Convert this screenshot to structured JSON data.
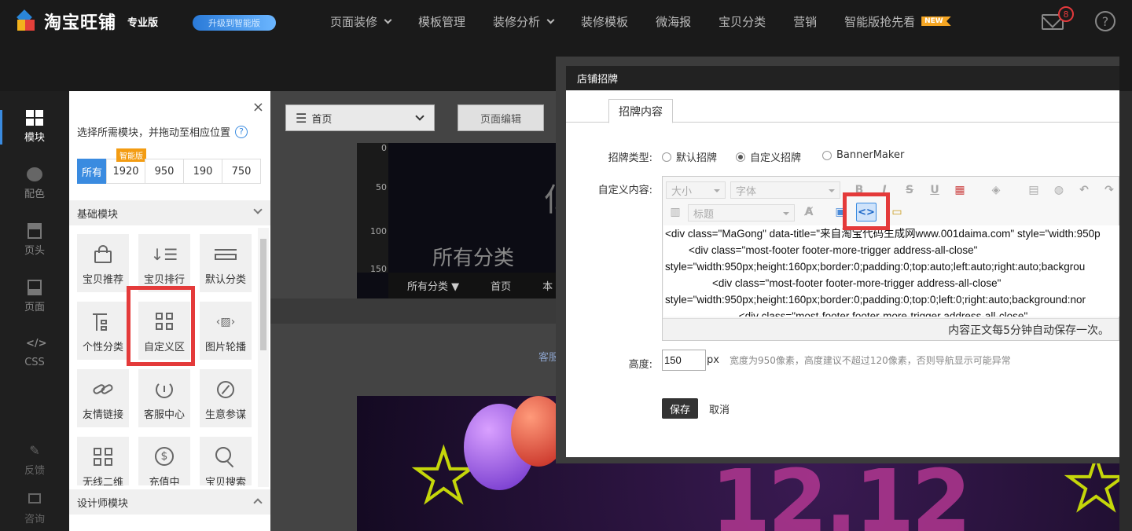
{
  "topbar": {
    "logo_text": "淘宝旺铺",
    "edition": "专业版",
    "upgrade": "升级到智能版",
    "nav": [
      {
        "label": "页面装修",
        "dropdown": true
      },
      {
        "label": "模板管理",
        "dropdown": false
      },
      {
        "label": "装修分析",
        "dropdown": true
      },
      {
        "label": "装修模板",
        "dropdown": false
      },
      {
        "label": "微海报",
        "dropdown": false
      },
      {
        "label": "宝贝分类",
        "dropdown": false
      },
      {
        "label": "营销",
        "dropdown": false
      },
      {
        "label": "智能版抢先看",
        "dropdown": false
      }
    ],
    "new_badge": "NEW",
    "mail_count": "8",
    "help": "?"
  },
  "rail": {
    "items": [
      {
        "label": "模块",
        "icon": "grid-icon"
      },
      {
        "label": "配色",
        "icon": "palette-icon"
      },
      {
        "label": "页头",
        "icon": "page-header-icon"
      },
      {
        "label": "页面",
        "icon": "page-icon"
      },
      {
        "label": "CSS",
        "icon": "code-icon"
      },
      {
        "label": "反馈",
        "icon": "edit-icon"
      },
      {
        "label": "咨询",
        "icon": "chat-icon"
      }
    ]
  },
  "panel": {
    "close": "×",
    "hint": "选择所需模块，并拖动至相应位置",
    "filters": [
      "所有",
      "1920",
      "950",
      "190",
      "750"
    ],
    "smart_badge": "智能版",
    "section_basic": "基础模块",
    "section_designer": "设计师模块",
    "modules": [
      {
        "label": "宝贝推荐",
        "icon": "bag-icon"
      },
      {
        "label": "宝贝排行",
        "icon": "ranking-icon"
      },
      {
        "label": "默认分类",
        "icon": "category-icon"
      },
      {
        "label": "个性分类",
        "icon": "tree-icon"
      },
      {
        "label": "自定义区",
        "icon": "custom-grid-icon"
      },
      {
        "label": "图片轮播",
        "icon": "carousel-icon"
      },
      {
        "label": "友情链接",
        "icon": "link-icon"
      },
      {
        "label": "客服中心",
        "icon": "service-icon"
      },
      {
        "label": "生意参谋",
        "icon": "compass-icon"
      },
      {
        "label": "无线二维",
        "icon": "qrcode-icon"
      },
      {
        "label": "充值中",
        "icon": "coin-icon"
      },
      {
        "label": "宝贝搜索",
        "icon": "search-icon"
      }
    ]
  },
  "editor": {
    "page_select": "首页",
    "page_edit": "页面编辑",
    "preview_title": "所有分类",
    "preview_big_char": "亿",
    "preview_nav": [
      "所有分类 ▼",
      "首页",
      "本"
    ],
    "ruler": [
      "0",
      "50",
      "100",
      "150"
    ],
    "kefu": "客服中",
    "banner_text": "12.12"
  },
  "dialog": {
    "title": "店铺招牌",
    "tab": "招牌内容",
    "type_label": "招牌类型:",
    "types": [
      {
        "label": "默认招牌",
        "checked": false
      },
      {
        "label": "自定义招牌",
        "checked": true
      },
      {
        "label": "BannerMaker",
        "checked": false
      }
    ],
    "content_label": "自定义内容:",
    "toolbar": {
      "size_placeholder": "大小",
      "font_placeholder": "字体",
      "heading_placeholder": "标题",
      "source_button": "<>"
    },
    "code_lines": [
      "<div class=\"MaGong\" data-title=\"来自淘宝代码生成网www.001daima.com\" style=\"width:950p",
      "        <div class=\"most-footer footer-more-trigger address-all-close\"",
      "style=\"width:950px;height:160px;border:0;padding:0;top:auto;left:auto;right:auto;backgrou",
      "                <div class=\"most-footer footer-more-trigger address-all-close\"",
      "style=\"width:950px;height:160px;border:0;padding:0;top:0;left:0;right:auto;background:nor",
      "                         <div class=\"most-footer footer-more-trigger address-all-close\""
    ],
    "autosave": "内容正文每5分钟自动保存一次。",
    "height_label": "高度:",
    "height_value": "150",
    "height_unit": "px",
    "height_note": "宽度为950像素，高度建议不超过120像素，否则导航显示可能异常",
    "save": "保存",
    "cancel": "取消"
  },
  "colors": {
    "accent": "#3a8be0",
    "highlight": "#e43a3a",
    "topbar_bg": "#1a1a1a"
  }
}
